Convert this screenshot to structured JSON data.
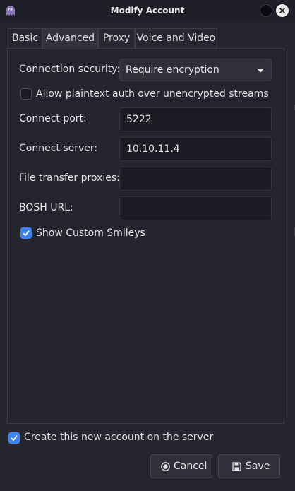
{
  "window": {
    "title": "Modify Account",
    "app_icon": "pidgin-icon",
    "controls": [
      "minimize-icon",
      "close-icon"
    ]
  },
  "tabs": [
    {
      "label": "Basic",
      "active": false
    },
    {
      "label": "Advanced",
      "active": true
    },
    {
      "label": "Proxy",
      "active": false
    },
    {
      "label": "Voice and Video",
      "active": false
    }
  ],
  "advanced": {
    "connection_security": {
      "label": "Connection security:",
      "value": "Require encryption"
    },
    "allow_plaintext": {
      "label": "Allow plaintext auth over unencrypted streams",
      "checked": false
    },
    "connect_port": {
      "label": "Connect port:",
      "value": "5222"
    },
    "connect_server": {
      "label": "Connect server:",
      "value": "10.10.11.4"
    },
    "file_transfer_proxies": {
      "label": "File transfer proxies:",
      "value": ""
    },
    "bosh_url": {
      "label": "BOSH URL:",
      "value": ""
    },
    "show_custom_smileys": {
      "label": "Show Custom Smileys",
      "checked": true
    }
  },
  "footer": {
    "create_account": {
      "label": "Create this new account on the server",
      "checked": true
    },
    "cancel_label": "Cancel",
    "save_label": "Save"
  },
  "colors": {
    "accent": "#3b82f0",
    "background": "#24252e",
    "titlebar": "#1e1f27"
  }
}
